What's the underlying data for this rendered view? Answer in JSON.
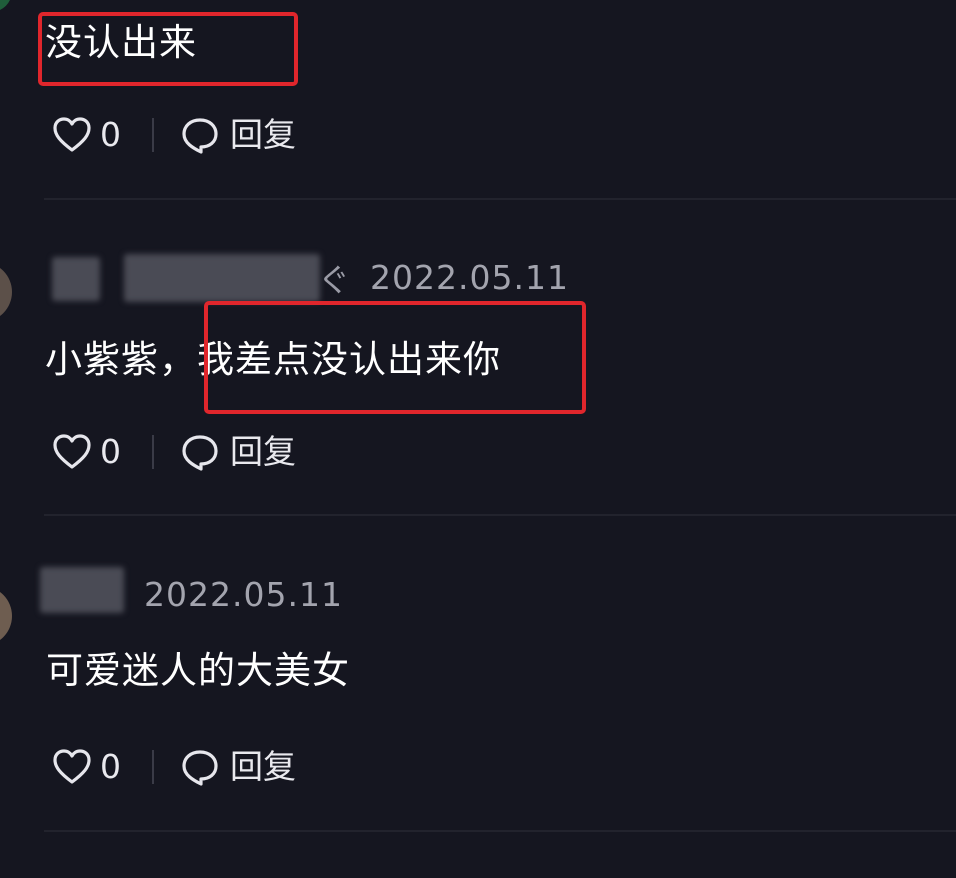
{
  "comments": [
    {
      "text": "没认出来",
      "likes": "0",
      "reply_label": "回复"
    },
    {
      "username_tail": "ぐ",
      "timestamp": "2022.05.11",
      "text_prefix": "小紫紫，",
      "text_highlight": "我差点没认出来你",
      "likes": "0",
      "reply_label": "回复"
    },
    {
      "timestamp": "2022.05.11",
      "text": "可爱迷人的大美女",
      "likes": "0",
      "reply_label": "回复"
    }
  ],
  "icons": {
    "like": "heart-outline-icon",
    "reply": "speech-bubble-icon"
  },
  "colors": {
    "background": "#151620",
    "highlight_border": "#e0262c",
    "text": "#ffffff",
    "meta_text": "#a3a4ae"
  }
}
